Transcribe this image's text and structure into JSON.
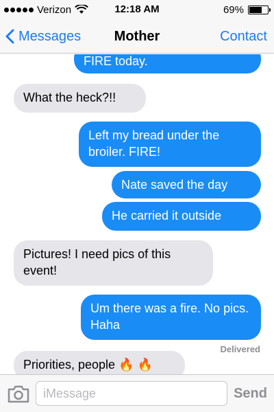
{
  "status_bar": {
    "carrier": "Verizon",
    "time": "12:18 AM",
    "battery_percent": "69%",
    "battery_level": 0.69,
    "signal_icon": "signal-dots-icon",
    "wifi_icon": "wifi-icon",
    "battery_icon": "battery-icon"
  },
  "nav": {
    "back_label": "Messages",
    "title": "Mother",
    "contact_label": "Contact"
  },
  "messages": [
    {
      "from": "me",
      "text": "FIRE today."
    },
    {
      "from": "them",
      "text": "What the heck?!!"
    },
    {
      "from": "me",
      "text": "Left my bread under the broiler. FIRE!"
    },
    {
      "from": "me",
      "text": "Nate saved the day"
    },
    {
      "from": "me",
      "text": "He carried it outside"
    },
    {
      "from": "them",
      "text": "Pictures! I need pics of this event!"
    },
    {
      "from": "me",
      "text": "Um there was a fire. No pics. Haha"
    },
    {
      "from": "them",
      "text": "Priorities, people 🔥 🔥"
    }
  ],
  "delivered_label": "Delivered",
  "input": {
    "placeholder": "iMessage",
    "value": "",
    "send_label": "Send"
  },
  "colors": {
    "accent": "#1a7cf5",
    "sent_bubble": "#1a8cf6",
    "received_bubble": "#e5e5ea"
  }
}
